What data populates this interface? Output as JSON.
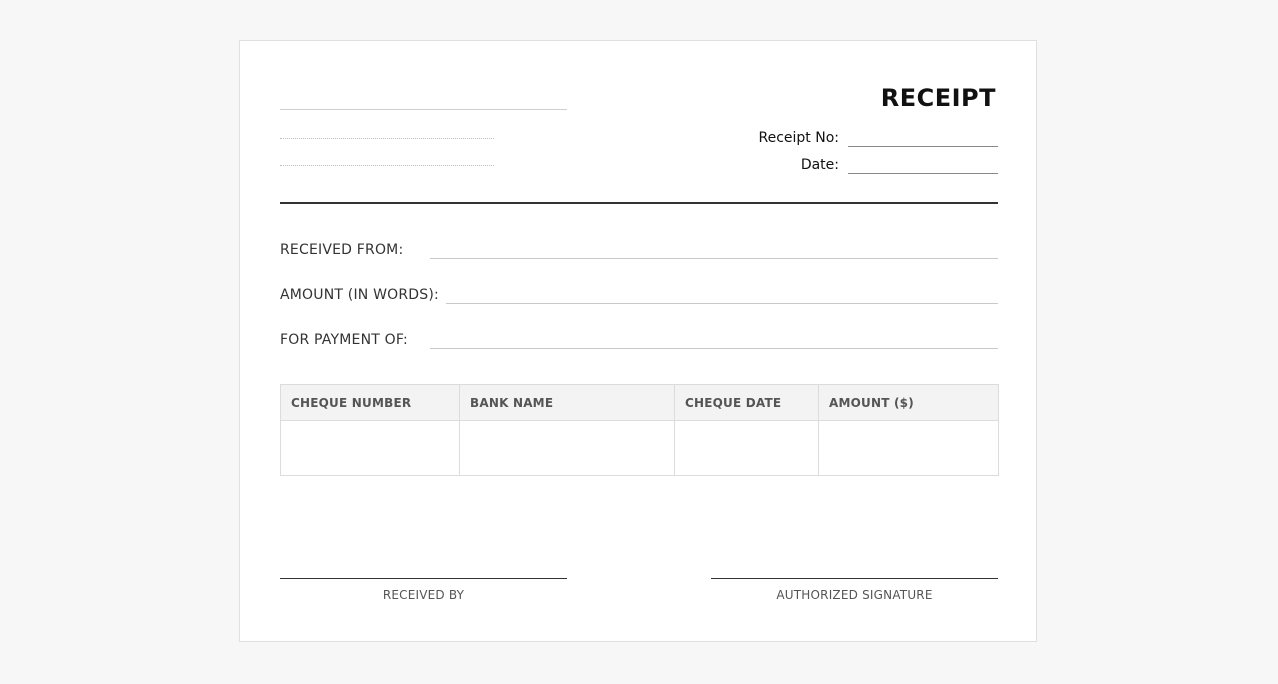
{
  "receipt": {
    "title": "RECEIPT",
    "receipt_no_label": "Receipt No:",
    "date_label": "Date:"
  },
  "fields": {
    "received_from_label": "RECEIVED FROM:",
    "amount_words_label": "AMOUNT (IN WORDS):",
    "payment_for_label": "FOR PAYMENT OF:"
  },
  "table": {
    "headers": [
      "CHEQUE NUMBER",
      "BANK NAME",
      "CHEQUE DATE",
      "AMOUNT ($)"
    ],
    "rows": [
      [
        "",
        "",
        "",
        ""
      ]
    ]
  },
  "signatures": {
    "received_by_label": "RECEIVED BY",
    "authorized_label": "AUTHORIZED SIGNATURE"
  }
}
